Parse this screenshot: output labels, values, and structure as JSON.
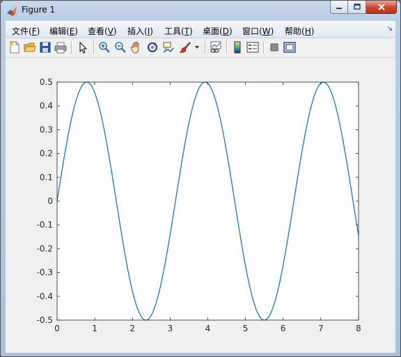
{
  "window": {
    "title": "Figure 1"
  },
  "menu": [
    {
      "label": "文件(F)",
      "mnemonic": "F",
      "prefix": "文件(",
      "suffix": ")"
    },
    {
      "label": "编辑(E)",
      "mnemonic": "E",
      "prefix": "编辑(",
      "suffix": ")"
    },
    {
      "label": "查看(V)",
      "mnemonic": "V",
      "prefix": "查看(",
      "suffix": ")"
    },
    {
      "label": "插入(I)",
      "mnemonic": "I",
      "prefix": "插入(",
      "suffix": ")"
    },
    {
      "label": "工具(T)",
      "mnemonic": "T",
      "prefix": "工具(",
      "suffix": ")"
    },
    {
      "label": "桌面(D)",
      "mnemonic": "D",
      "prefix": "桌面(",
      "suffix": ")"
    },
    {
      "label": "窗口(W)",
      "mnemonic": "W",
      "prefix": "窗口(",
      "suffix": ")"
    },
    {
      "label": "帮助(H)",
      "mnemonic": "H",
      "prefix": "帮助(",
      "suffix": ")"
    }
  ],
  "toolbar_icons": [
    "new-figure-icon",
    "open-file-icon",
    "save-icon",
    "print-icon",
    "edit-plot-arrow-icon",
    "zoom-in-icon",
    "zoom-out-icon",
    "pan-hand-icon",
    "rotate-3d-icon",
    "data-cursor-icon",
    "brush-icon",
    "brush-dropdown-icon",
    "link-plot-icon",
    "colorbar-icon",
    "legend-icon",
    "hide-plot-tools-icon",
    "show-plot-tools-icon"
  ],
  "chart_data": {
    "type": "line",
    "function_samples": "y = 0.5*sin(2x)",
    "x": [
      0,
      0.25,
      0.5,
      0.75,
      1,
      1.25,
      1.5,
      1.75,
      2,
      2.25,
      2.5,
      2.75,
      3,
      3.25,
      3.5,
      3.75,
      4,
      4.25,
      4.5,
      4.75,
      5,
      5.25,
      5.5,
      5.75,
      6,
      6.25,
      6.5,
      6.75,
      7,
      7.25,
      7.5,
      7.75,
      8
    ],
    "y": [
      0,
      0.24,
      0.421,
      0.499,
      0.455,
      0.299,
      0.071,
      -0.175,
      -0.378,
      -0.489,
      -0.479,
      -0.353,
      -0.14,
      0.108,
      0.329,
      0.469,
      0.495,
      0.398,
      0.206,
      -0.037,
      -0.272,
      -0.44,
      -0.5,
      -0.436,
      -0.268,
      -0.033,
      0.21,
      0.4,
      0.495,
      0.467,
      0.325,
      0.105,
      -0.144
    ],
    "xlim": [
      0,
      8
    ],
    "ylim": [
      -0.5,
      0.5
    ],
    "xticks": [
      0,
      1,
      2,
      3,
      4,
      5,
      6,
      7,
      8
    ],
    "yticks": [
      0.5,
      0.4,
      0.3,
      0.2,
      0.1,
      0,
      -0.1,
      -0.2,
      -0.3,
      -0.4,
      -0.5
    ],
    "xtick_labels": [
      "0",
      "1",
      "2",
      "3",
      "4",
      "5",
      "6",
      "7",
      "8"
    ],
    "ytick_labels": [
      "0.5",
      "0.4",
      "0.3",
      "0.2",
      "0.1",
      "0",
      "-0.1",
      "-0.2",
      "-0.3",
      "-0.4",
      "-0.5"
    ],
    "line_color": "#0072BD",
    "grid": false
  }
}
